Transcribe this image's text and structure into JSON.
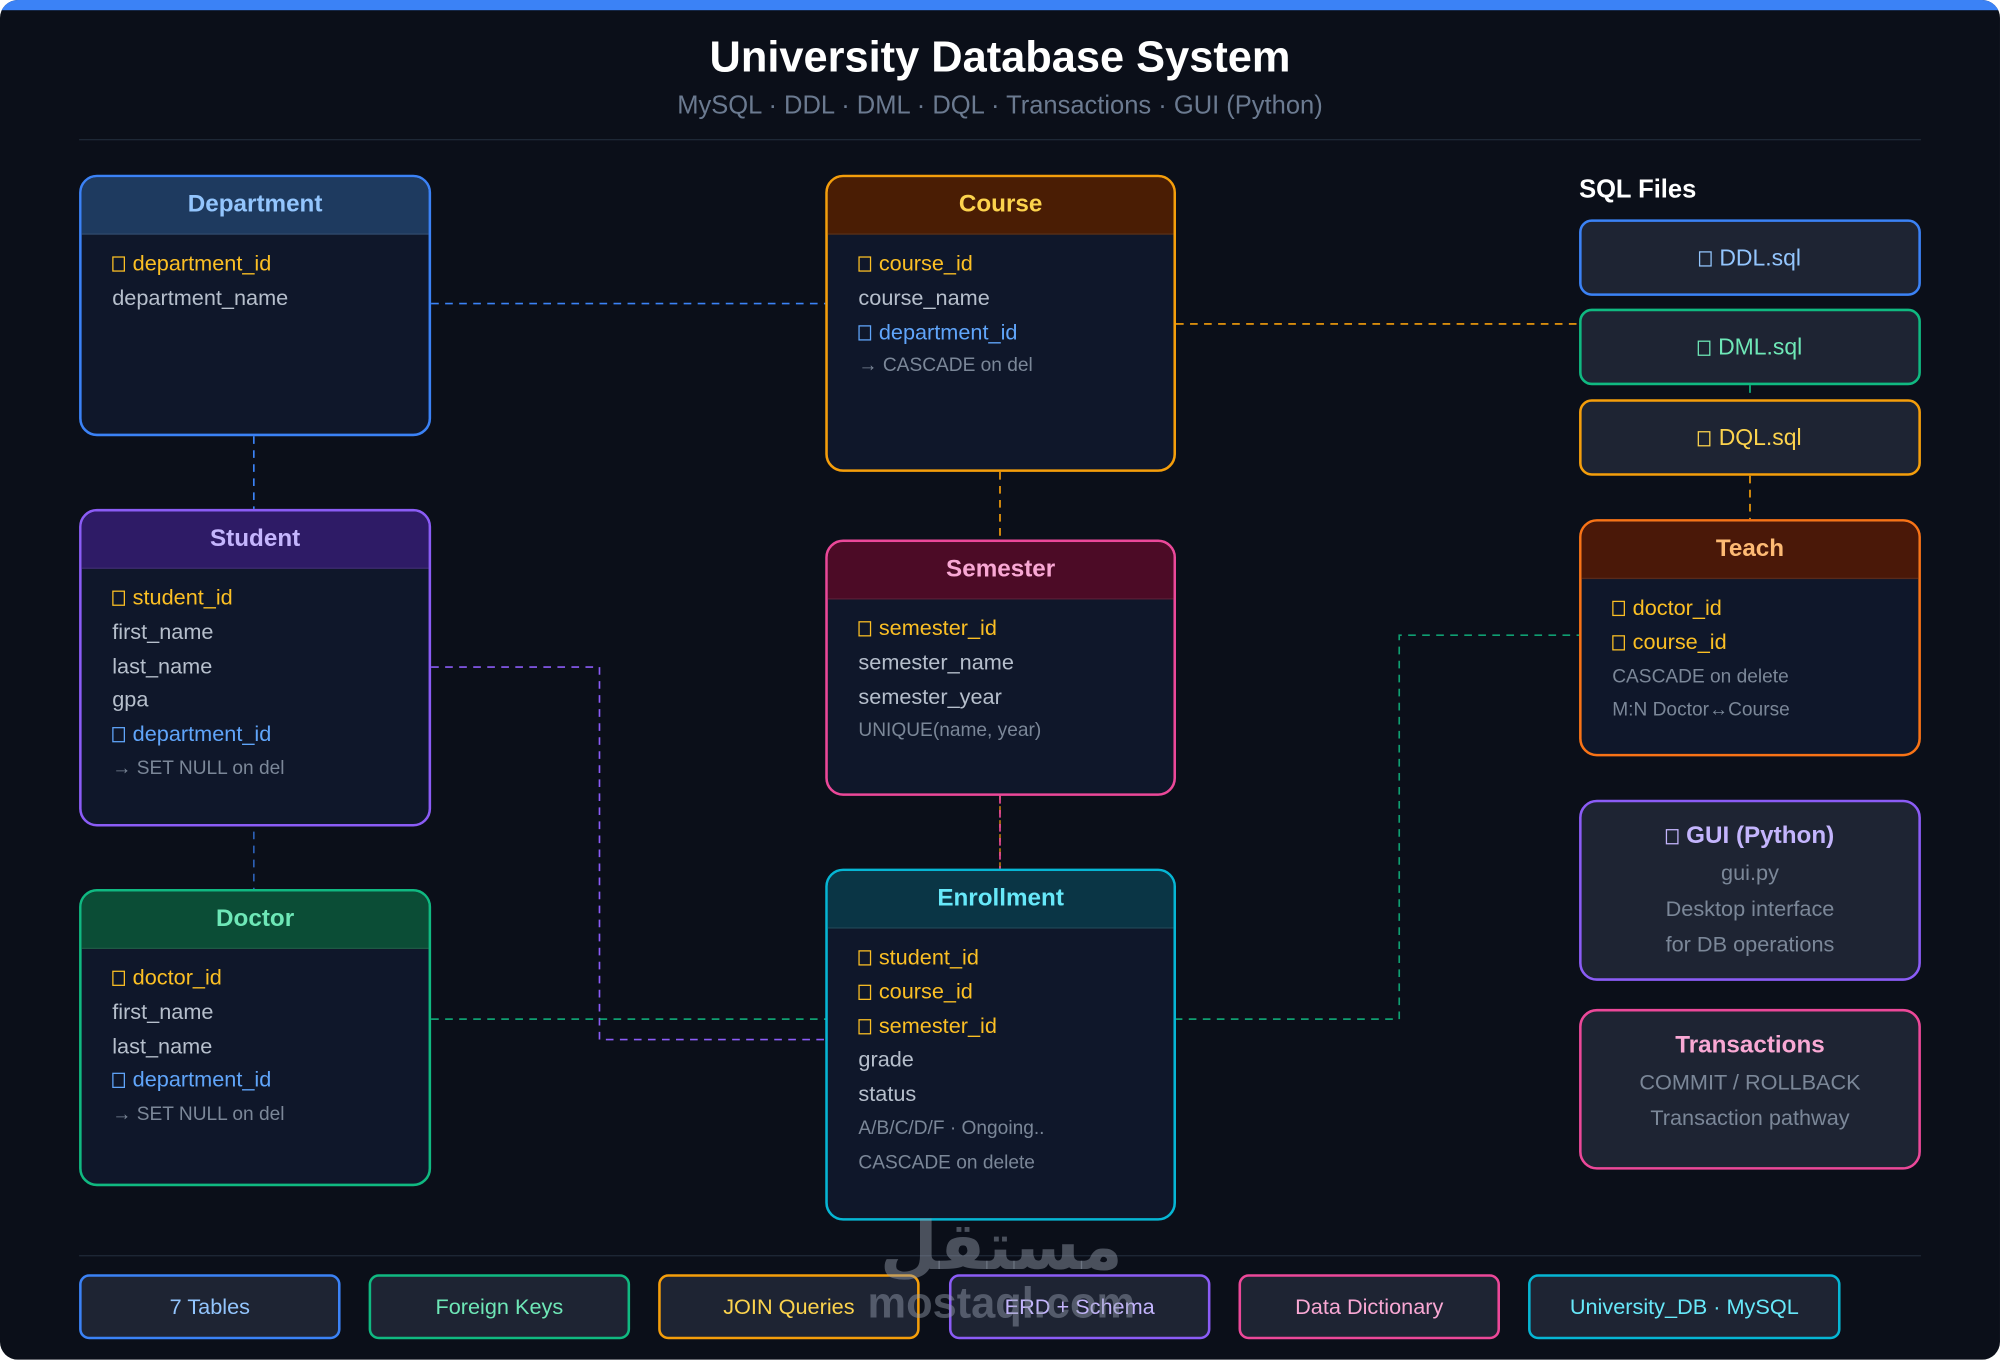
{
  "title": "University Database System",
  "subtitle": "MySQL · DDL · DML · DQL · Transactions · GUI (Python)",
  "colors": {
    "department": "#3b82f6",
    "student": "#8b5cf6",
    "doctor": "#10b981",
    "course": "#f59e0b",
    "semester": "#ec4899",
    "enrollment": "#06b6d4",
    "teach": "#f97316",
    "primary_key": "#fbbf24",
    "foreign_key": "#60a5fa"
  },
  "entities": {
    "department": {
      "name": "Department",
      "rows": [
        "department_id",
        "department_name"
      ]
    },
    "student": {
      "name": "Student",
      "rows": [
        "student_id",
        "first_name",
        "last_name",
        "gpa",
        "department_id",
        "→ SET NULL on del"
      ]
    },
    "doctor": {
      "name": "Doctor",
      "rows": [
        "doctor_id",
        "first_name",
        "last_name",
        "department_id",
        "→ SET NULL on del"
      ]
    },
    "course": {
      "name": "Course",
      "rows": [
        "course_id",
        "course_name",
        "department_id",
        "→ CASCADE on del"
      ]
    },
    "semester": {
      "name": "Semester",
      "rows": [
        "semester_id",
        "semester_name",
        "semester_year",
        "UNIQUE(name, year)"
      ]
    },
    "enrollment": {
      "name": "Enrollment",
      "rows": [
        "student_id",
        "course_id",
        "semester_id",
        "grade",
        "status",
        "A/B/C/D/F · Ongoing..",
        "CASCADE on delete"
      ]
    },
    "teach": {
      "name": "Teach",
      "rows": [
        "doctor_id",
        "course_id",
        "CASCADE on delete",
        "M:N Doctor↔Course"
      ]
    }
  },
  "sql_files": {
    "heading": "SQL Files",
    "files": [
      "DDL.sql",
      "DML.sql",
      "DQL.sql"
    ]
  },
  "gui": {
    "title": "GUI (Python)",
    "lines": [
      "gui.py",
      "Desktop interface",
      "for DB operations"
    ]
  },
  "transactions": {
    "title": "Transactions",
    "lines": [
      "COMMIT / ROLLBACK",
      "Transaction pathway"
    ]
  },
  "pills": [
    "7 Tables",
    "Foreign Keys",
    "JOIN Queries",
    "ERD + Schema",
    "Data Dictionary",
    "University_DB · MySQL"
  ],
  "watermark": {
    "arabic": "مستقل",
    "latin": "mostaql.com"
  }
}
